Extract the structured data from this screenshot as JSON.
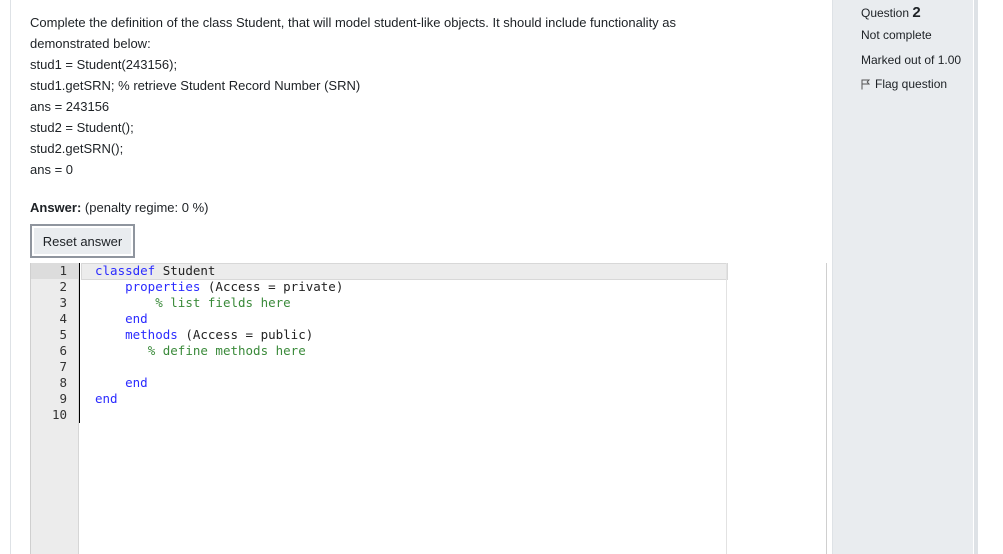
{
  "question": {
    "intro_line1": "Complete the definition of the class Student, that will model student-like objects. It should include functionality as",
    "intro_line2": "demonstrated below:",
    "example_lines": [
      "stud1 = Student(243156);",
      "stud1.getSRN; % retrieve Student Record Number (SRN)",
      "ans = 243156",
      "stud2 = Student();",
      "stud2.getSRN();",
      "ans = 0"
    ]
  },
  "answer": {
    "label": "Answer:",
    "penalty": "(penalty regime: 0 %)",
    "reset_label": "Reset answer"
  },
  "editor": {
    "line_numbers": [
      "1",
      "2",
      "3",
      "4",
      "5",
      "6",
      "7",
      "8",
      "9",
      "10"
    ],
    "lines": [
      {
        "indent": "",
        "kw": "classdef",
        "rest": " Student",
        "comment": ""
      },
      {
        "indent": "    ",
        "kw": "properties",
        "rest": " (Access = private)",
        "comment": ""
      },
      {
        "indent": "        ",
        "kw": "",
        "rest": "",
        "comment": "% list fields here"
      },
      {
        "indent": "    ",
        "kw": "end",
        "rest": "",
        "comment": ""
      },
      {
        "indent": "    ",
        "kw": "methods",
        "rest": " (Access = public)",
        "comment": ""
      },
      {
        "indent": "       ",
        "kw": "",
        "rest": "",
        "comment": "% define methods here"
      },
      {
        "indent": "",
        "kw": "",
        "rest": "",
        "comment": ""
      },
      {
        "indent": "    ",
        "kw": "end",
        "rest": "",
        "comment": ""
      },
      {
        "indent": "",
        "kw": "end",
        "rest": "",
        "comment": ""
      },
      {
        "indent": "",
        "kw": "",
        "rest": "",
        "comment": ""
      }
    ]
  },
  "info": {
    "question_prefix": "Question ",
    "question_number": "2",
    "state": "Not complete",
    "grade": "Marked out of 1.00",
    "flag_label": "Flag question"
  }
}
